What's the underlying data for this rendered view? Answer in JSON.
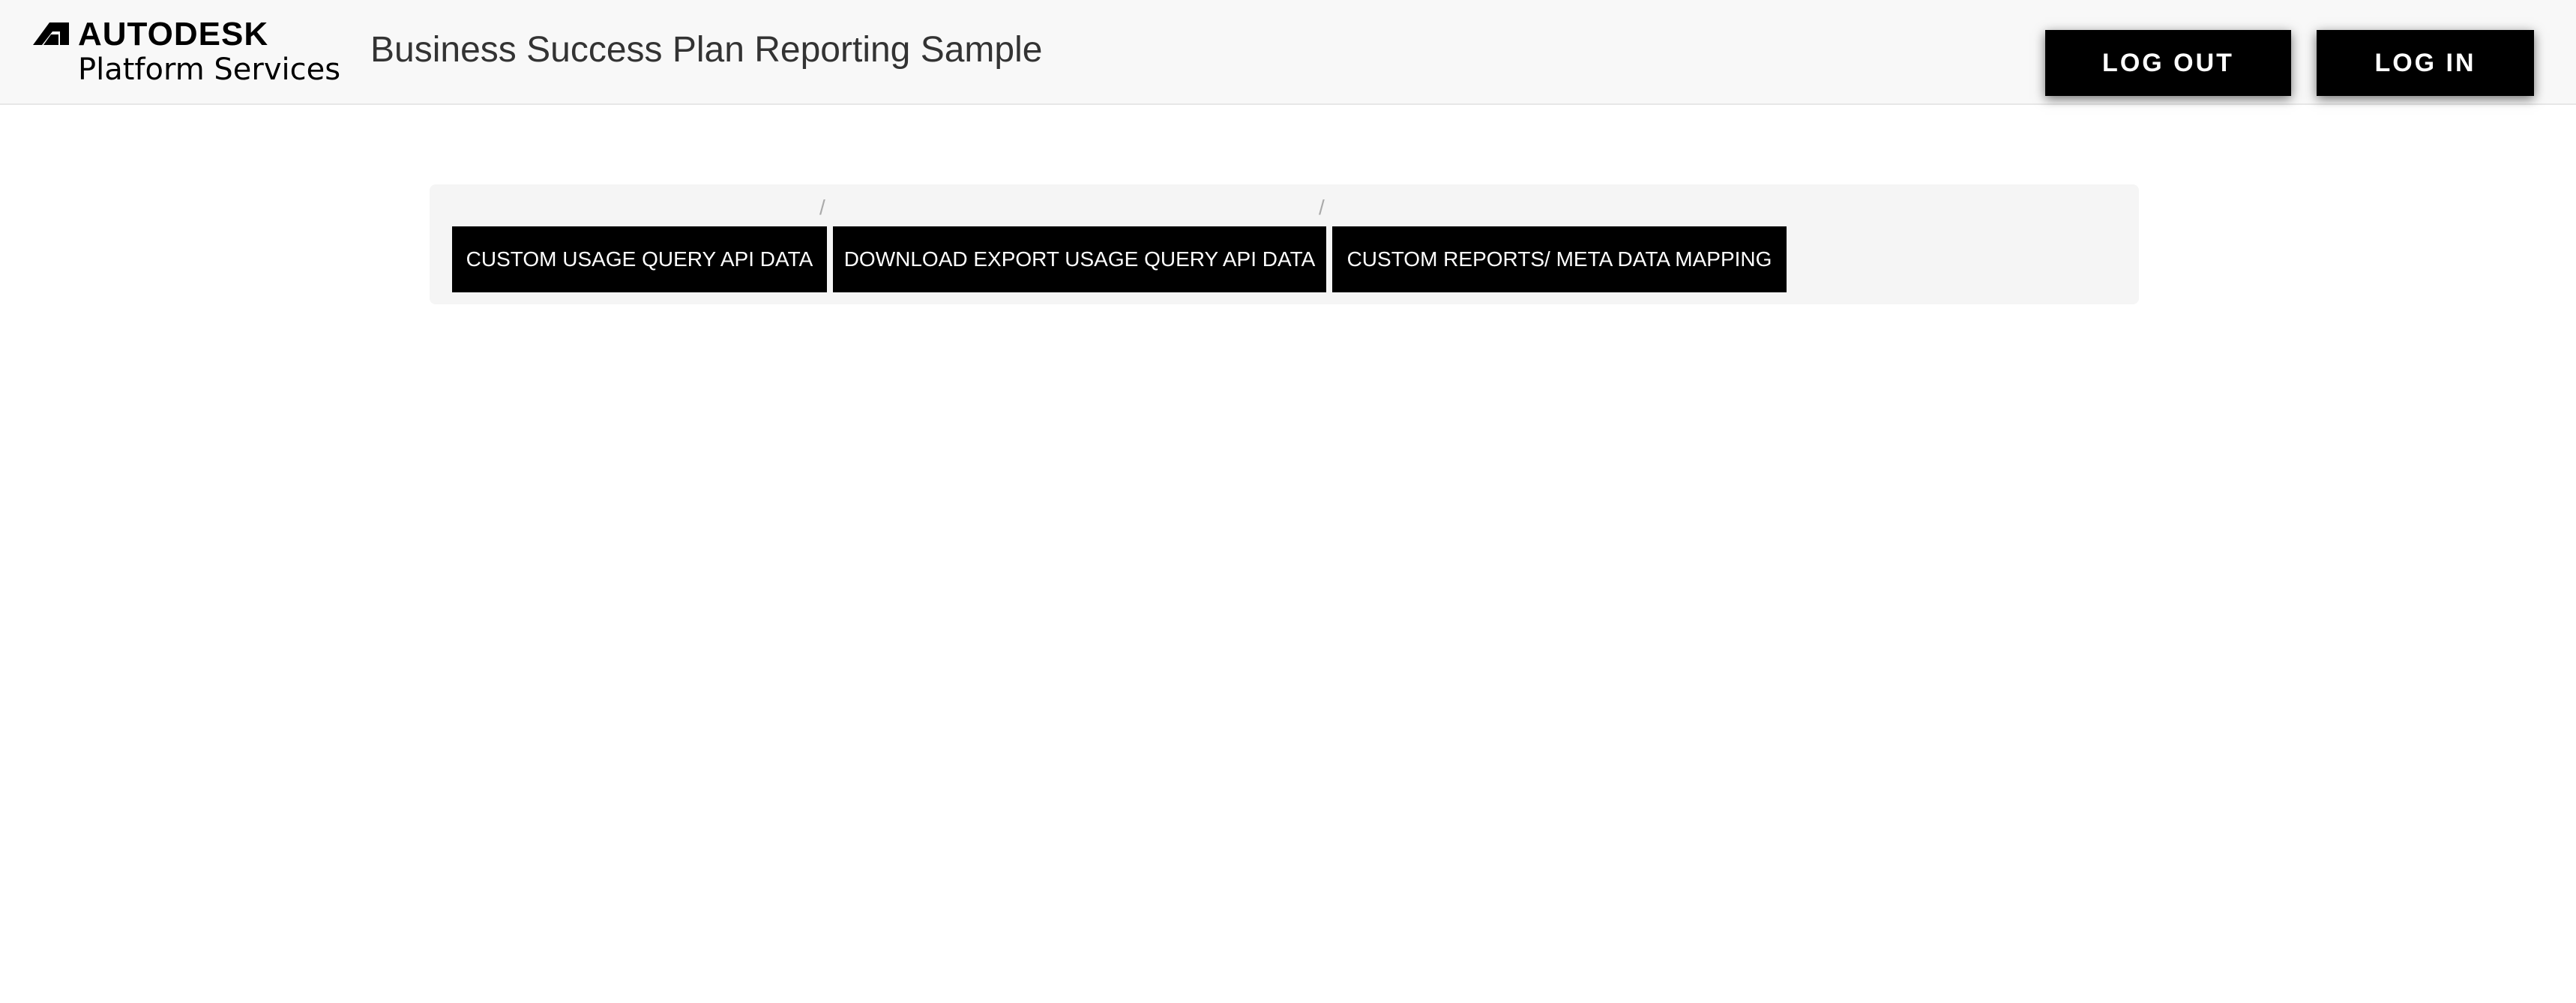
{
  "header": {
    "logo": {
      "brand": "AUTODESK",
      "product": "Platform Services",
      "icon": "autodesk-logo-icon"
    },
    "title": "Business Success Plan Reporting Sample",
    "buttons": {
      "logout_label": "LOG OUT",
      "login_label": "LOG IN"
    },
    "colors": {
      "navbar_background": "#f8f8f8",
      "button_background": "#000000",
      "button_text": "#ffffff"
    }
  },
  "breadcrumb": {
    "separator": "/",
    "items": [
      {
        "label": "CUSTOM USAGE QUERY API DATA"
      },
      {
        "label": "DOWNLOAD EXPORT USAGE QUERY API DATA"
      },
      {
        "label": "CUSTOM REPORTS/ META DATA MAPPING"
      }
    ],
    "colors": {
      "panel_background": "#f5f5f5",
      "item_background": "#000000",
      "separator": "#aaaaaa"
    }
  }
}
